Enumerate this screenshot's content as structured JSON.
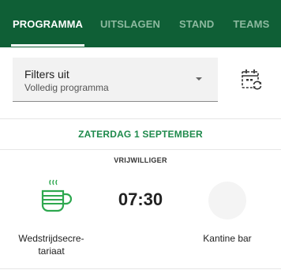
{
  "tabs": [
    {
      "label": "PROGRAMMA",
      "active": true
    },
    {
      "label": "UITSLAGEN",
      "active": false
    },
    {
      "label": "STAND",
      "active": false
    },
    {
      "label": "TEAMS",
      "active": false
    }
  ],
  "filter": {
    "title": "Filters uit",
    "subtitle": "Volledig programma"
  },
  "icons": {
    "dropdown": "caret-down-icon",
    "calendar_sync": "calendar-sync-icon",
    "duty": "coffee-cup-icon"
  },
  "schedule": {
    "date": "ZATERDAG 1 SEPTEMBER",
    "role": "VRIJWILLIGER",
    "duty": {
      "time": "07:30",
      "name_line1": "Wedstrijdsecre-",
      "name_line2": "tariaat",
      "location": "Kantine bar"
    }
  },
  "colors": {
    "header_bg": "#0f5f36",
    "accent": "#1f8a4c",
    "icon_green": "#2ea84f"
  }
}
